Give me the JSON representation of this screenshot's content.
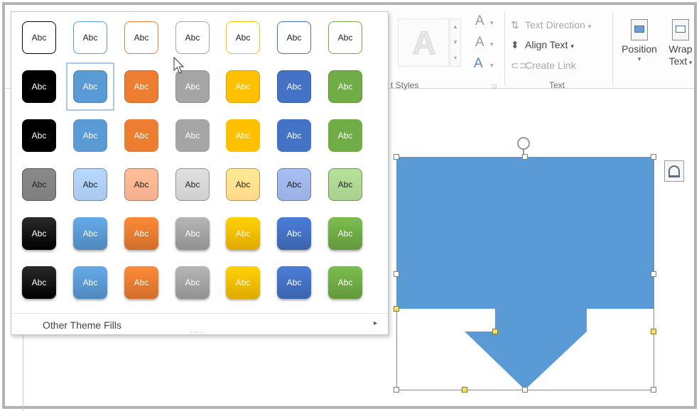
{
  "ribbon": {
    "wordart_styles_label": "t Styles",
    "text_group_label": "Text",
    "text_direction": "Text Direction",
    "align_text": "Align Text",
    "create_link": "Create Link",
    "position": "Position",
    "wrap_text_line1": "Wrap",
    "wrap_text_line2": "Text"
  },
  "gallery": {
    "swatch_label": "Abc",
    "other_fills": "Other Theme Fills",
    "rows": [
      {
        "style": "outline",
        "colors": [
          "#000000",
          "#5b9bd5",
          "#ed7d31",
          "#a5a5a5",
          "#ffc000",
          "#4472c4",
          "#70ad47"
        ]
      },
      {
        "style": "solid",
        "colors": [
          "#000000",
          "#5b9bd5",
          "#ed7d31",
          "#a5a5a5",
          "#ffc000",
          "#4472c4",
          "#70ad47"
        ]
      },
      {
        "style": "solid-flat",
        "colors": [
          "#000000",
          "#5b9bd5",
          "#ed7d31",
          "#a5a5a5",
          "#ffc000",
          "#4472c4",
          "#70ad47"
        ]
      },
      {
        "style": "light",
        "colors": [
          "#7f7f7f",
          "#a9c8ec",
          "#f4b08f",
          "#cfcfcf",
          "#ffd98a",
          "#9bb1e2",
          "#a9d18e"
        ]
      },
      {
        "style": "gradient",
        "colors": [
          "#000000",
          "#5b9bd5",
          "#ed7d31",
          "#a5a5a5",
          "#ffc000",
          "#4472c4",
          "#70ad47"
        ]
      },
      {
        "style": "gradient-strong",
        "colors": [
          "#000000",
          "#5b9bd5",
          "#ed7d31",
          "#a5a5a5",
          "#ffc000",
          "#4472c4",
          "#70ad47"
        ]
      }
    ],
    "selected": {
      "row": 1,
      "col": 1
    }
  },
  "shape": {
    "fill_color": "#5b9bd5"
  }
}
